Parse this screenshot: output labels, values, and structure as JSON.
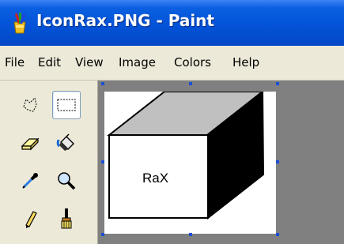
{
  "window": {
    "title": "IconRax.PNG - Paint",
    "app_icon": "paint-app-icon"
  },
  "menu": {
    "items": [
      {
        "label": "File"
      },
      {
        "label": "Edit"
      },
      {
        "label": "View"
      },
      {
        "label": "Image"
      },
      {
        "label": "Colors"
      },
      {
        "label": "Help"
      }
    ]
  },
  "toolbox": {
    "tools": [
      {
        "name": "free-form-select",
        "icon": "free-form-select-icon",
        "selected": false
      },
      {
        "name": "rectangle-select",
        "icon": "rectangle-select-icon",
        "selected": true
      },
      {
        "name": "eraser",
        "icon": "eraser-icon",
        "selected": false
      },
      {
        "name": "fill-with-color",
        "icon": "paint-bucket-icon",
        "selected": false
      },
      {
        "name": "pick-color",
        "icon": "eyedropper-icon",
        "selected": false
      },
      {
        "name": "magnifier",
        "icon": "magnifier-icon",
        "selected": false
      },
      {
        "name": "pencil",
        "icon": "pencil-icon",
        "selected": false
      },
      {
        "name": "brush",
        "icon": "brush-icon",
        "selected": false
      }
    ]
  },
  "canvas": {
    "image_text": "RaX"
  },
  "colors": {
    "titlebar": "#0453d8",
    "workspace": "#808080",
    "selection_handle": "#1c4fd4",
    "cube_top": "#c0c0c0",
    "cube_side": "#000000"
  }
}
